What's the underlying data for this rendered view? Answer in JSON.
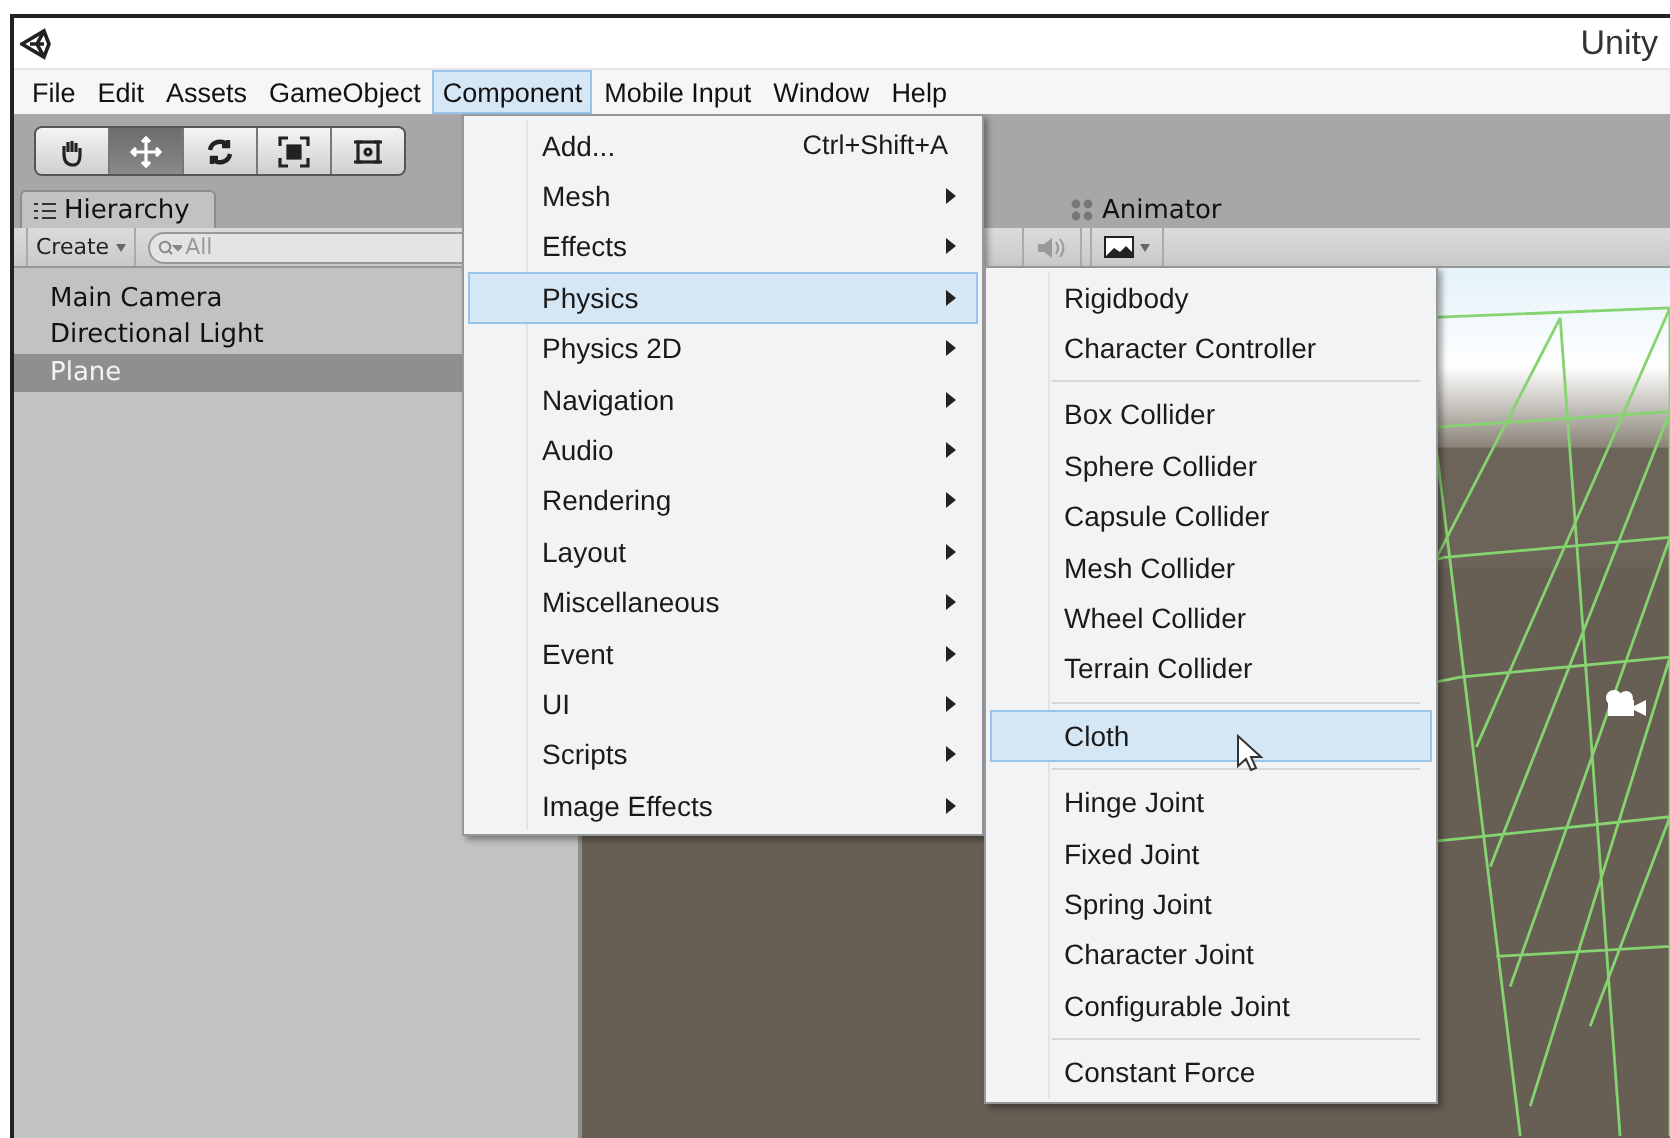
{
  "window": {
    "title": "Unity"
  },
  "menubar": [
    {
      "label": "File",
      "selected": false
    },
    {
      "label": "Edit",
      "selected": false
    },
    {
      "label": "Assets",
      "selected": false
    },
    {
      "label": "GameObject",
      "selected": false
    },
    {
      "label": "Component",
      "selected": true
    },
    {
      "label": "Mobile Input",
      "selected": false
    },
    {
      "label": "Window",
      "selected": false
    },
    {
      "label": "Help",
      "selected": false
    }
  ],
  "tools": [
    {
      "kind": "hand",
      "selected": false
    },
    {
      "kind": "move",
      "selected": true
    },
    {
      "kind": "rotate",
      "selected": false
    },
    {
      "kind": "scale",
      "selected": false
    },
    {
      "kind": "rect",
      "selected": false
    }
  ],
  "hierarchy": {
    "tab": {
      "label": "Hierarchy",
      "selected": true
    },
    "create": "Create",
    "search": {
      "placeholder": "All"
    },
    "items": [
      {
        "label": "Main Camera",
        "selected": false
      },
      {
        "label": "Directional Light",
        "selected": false
      },
      {
        "label": "Plane",
        "selected": true
      }
    ]
  },
  "scene": {
    "tab": {
      "label": "Animator",
      "selected": false
    }
  },
  "component_menu": [
    {
      "label": "Add...",
      "shortcut": "Ctrl+Shift+A",
      "submenu": false,
      "selected": false
    },
    {
      "label": "Mesh",
      "submenu": true,
      "selected": false
    },
    {
      "label": "Effects",
      "submenu": true,
      "selected": false
    },
    {
      "label": "Physics",
      "submenu": true,
      "selected": true
    },
    {
      "label": "Physics 2D",
      "submenu": true,
      "selected": false
    },
    {
      "label": "Navigation",
      "submenu": true,
      "selected": false
    },
    {
      "label": "Audio",
      "submenu": true,
      "selected": false
    },
    {
      "label": "Rendering",
      "submenu": true,
      "selected": false
    },
    {
      "label": "Layout",
      "submenu": true,
      "selected": false
    },
    {
      "label": "Miscellaneous",
      "submenu": true,
      "selected": false
    },
    {
      "label": "Event",
      "submenu": true,
      "selected": false
    },
    {
      "label": "UI",
      "submenu": true,
      "selected": false
    },
    {
      "label": "Scripts",
      "submenu": true,
      "selected": false
    },
    {
      "label": "Image Effects",
      "submenu": true,
      "selected": false
    }
  ],
  "physics_menu": [
    {
      "kind": "item",
      "label": "Rigidbody",
      "selected": false
    },
    {
      "kind": "item",
      "label": "Character Controller",
      "selected": false
    },
    {
      "kind": "separator"
    },
    {
      "kind": "item",
      "label": "Box Collider",
      "selected": false
    },
    {
      "kind": "item",
      "label": "Sphere Collider",
      "selected": false
    },
    {
      "kind": "item",
      "label": "Capsule Collider",
      "selected": false
    },
    {
      "kind": "item",
      "label": "Mesh Collider",
      "selected": false
    },
    {
      "kind": "item",
      "label": "Wheel Collider",
      "selected": false
    },
    {
      "kind": "item",
      "label": "Terrain Collider",
      "selected": false
    },
    {
      "kind": "separator"
    },
    {
      "kind": "item",
      "label": "Cloth",
      "selected": true
    },
    {
      "kind": "separator"
    },
    {
      "kind": "item",
      "label": "Hinge Joint",
      "selected": false
    },
    {
      "kind": "item",
      "label": "Fixed Joint",
      "selected": false
    },
    {
      "kind": "item",
      "label": "Spring Joint",
      "selected": false
    },
    {
      "kind": "item",
      "label": "Character Joint",
      "selected": false
    },
    {
      "kind": "item",
      "label": "Configurable Joint",
      "selected": false
    },
    {
      "kind": "separator"
    },
    {
      "kind": "item",
      "label": "Constant Force",
      "selected": false
    }
  ]
}
